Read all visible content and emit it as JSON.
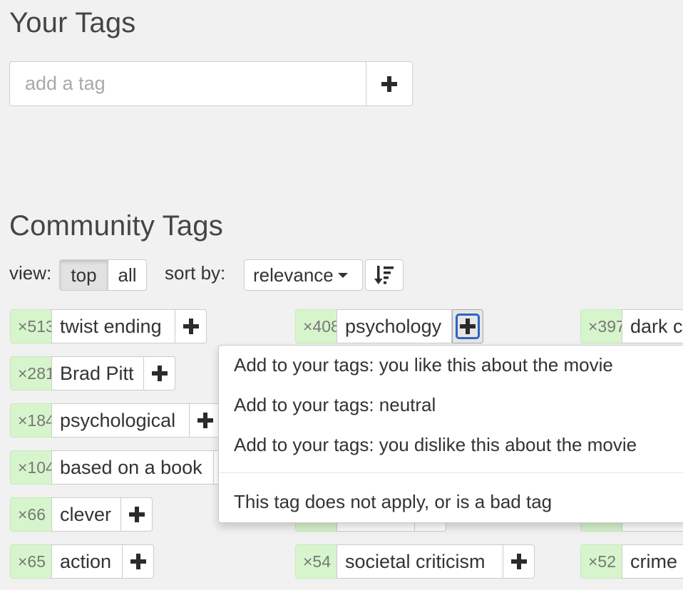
{
  "your_tags": {
    "title": "Your Tags",
    "input_placeholder": "add a tag"
  },
  "community_tags": {
    "title": "Community Tags",
    "view_label": "view:",
    "view_options": [
      "top",
      "all"
    ],
    "view_selected": "top",
    "sort_label": "sort by:",
    "sort_value": "relevance"
  },
  "tags": [
    {
      "count": "×513",
      "name": "twist ending"
    },
    {
      "count": "×408",
      "name": "psychology"
    },
    {
      "count": "×397",
      "name": "dark c"
    },
    {
      "count": "×281",
      "name": "Brad Pitt"
    },
    {
      "count": "×184",
      "name": "psychological"
    },
    {
      "count": "×104",
      "name": "based on a book"
    },
    {
      "count": "×66",
      "name": "clever"
    },
    {
      "count": "×65",
      "name": "action"
    },
    {
      "count": "×54",
      "name": "societal criticism"
    },
    {
      "count": "×52",
      "name": "crime"
    }
  ],
  "menu": {
    "items": [
      "Add to your tags: you like this about the movie",
      "Add to your tags: neutral",
      "Add to your tags: you dislike this about the movie",
      "This tag does not apply, or is a bad tag"
    ]
  },
  "colors": {
    "count_bg": "#d7f5cc",
    "focus_ring": "#2f62c2",
    "page_bg": "#f1f1f1"
  },
  "icons": {
    "add": "plus-icon",
    "sort_direction": "sort-descending-icon",
    "dropdown": "caret-down-icon"
  }
}
